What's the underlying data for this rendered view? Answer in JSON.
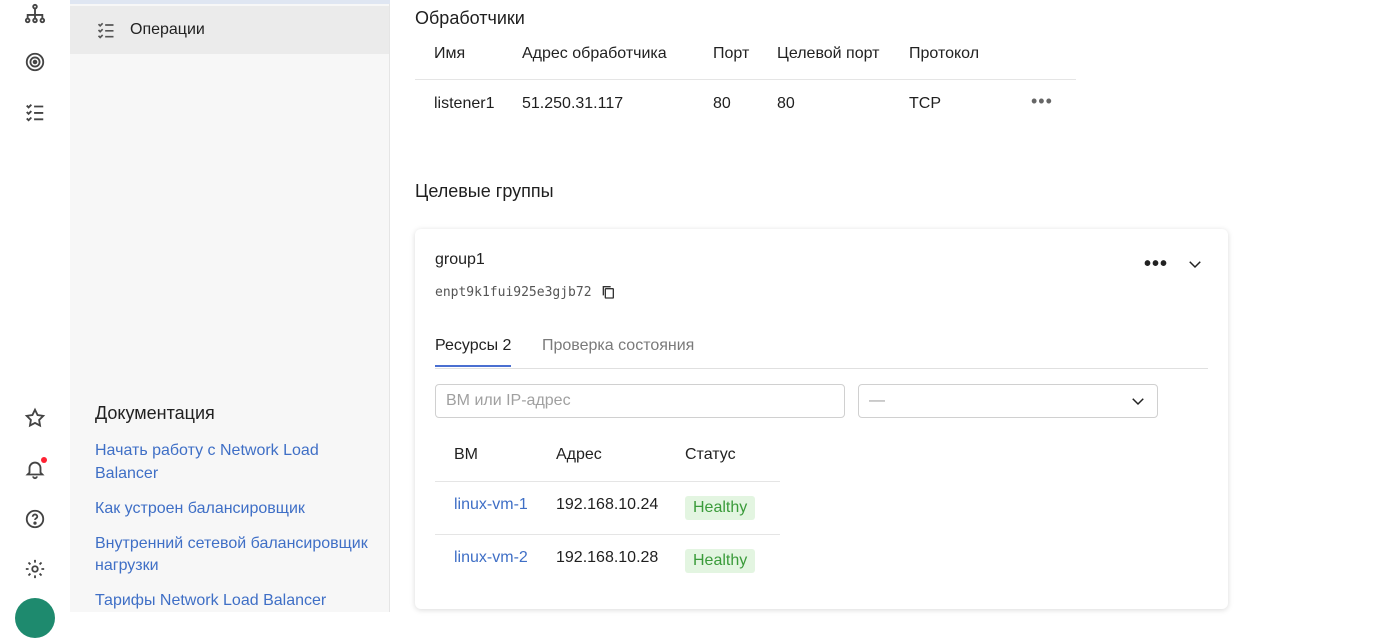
{
  "sidebar": {
    "active_item": "Операции",
    "docs_title": "Документация",
    "docs_links": [
      "Начать работу с Network Load Balancer",
      "Как устроен балансировщик",
      "Внутренний сетевой балансировщик нагрузки",
      "Тарифы Network Load Balancer"
    ]
  },
  "listeners": {
    "title": "Обработчики",
    "columns": [
      "Имя",
      "Адрес обработчика",
      "Порт",
      "Целевой порт",
      "Протокол"
    ],
    "rows": [
      {
        "name": "listener1",
        "address": "51.250.31.117",
        "port": "80",
        "target_port": "80",
        "protocol": "TCP"
      }
    ]
  },
  "target_groups": {
    "title": "Целевые группы",
    "group": {
      "name": "group1",
      "id": "enpt9k1fui925e3gjb72",
      "tabs": [
        "Ресурсы 2",
        "Проверка состояния"
      ],
      "search_placeholder": "ВМ или IP-адрес",
      "status_filter": "—",
      "columns": [
        "ВМ",
        "Адрес",
        "Статус"
      ],
      "rows": [
        {
          "vm": "linux-vm-1",
          "address": "192.168.10.24",
          "status": "Healthy"
        },
        {
          "vm": "linux-vm-2",
          "address": "192.168.10.28",
          "status": "Healthy"
        }
      ]
    }
  },
  "colors": {
    "link": "#3f6fc6",
    "healthy_bg": "#e3f5e1",
    "healthy_text": "#3a9b3a",
    "tab_accent": "#4a6fd1",
    "avatar": "#1e8a6e"
  }
}
